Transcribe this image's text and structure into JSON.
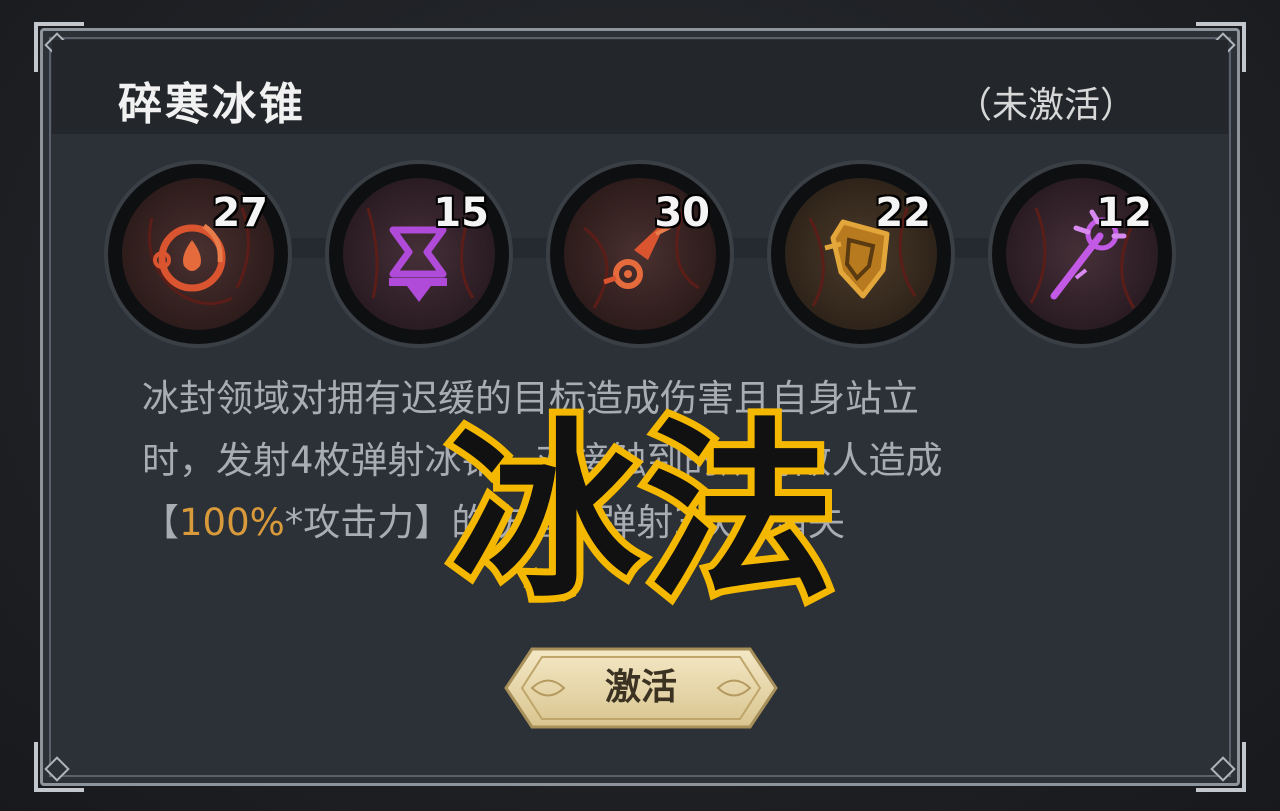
{
  "skill": {
    "title": "碎寒冰锥",
    "status": "（未激活）"
  },
  "requirements": [
    {
      "icon": "blood-drop-icon",
      "count": "27",
      "color": "#d9542f"
    },
    {
      "icon": "hourglass-icon",
      "count": "15",
      "color": "#b04ad8"
    },
    {
      "icon": "comet-icon",
      "count": "30",
      "color": "#d9542f"
    },
    {
      "icon": "shield-icon",
      "count": "22",
      "color": "#d9942a"
    },
    {
      "icon": "staff-icon",
      "count": "12",
      "color": "#c35ae6"
    }
  ],
  "description": {
    "line1": "冰封领域对拥有迟缓的目标造成伤害且自身站立",
    "line2": "时，发射4枚弹射冰锥，对接触到的所有敌人造成",
    "line3_prefix": "【",
    "line3_highlight": "100%",
    "line3_suffix": "*攻击力】的伤害，弹射3次后消失"
  },
  "overlay": "冰法",
  "button": {
    "activate_label": "激活"
  },
  "colors": {
    "highlight": "#d89a3a",
    "overlay_stroke": "#f5b800",
    "button_gold": "#e9d9ad"
  }
}
